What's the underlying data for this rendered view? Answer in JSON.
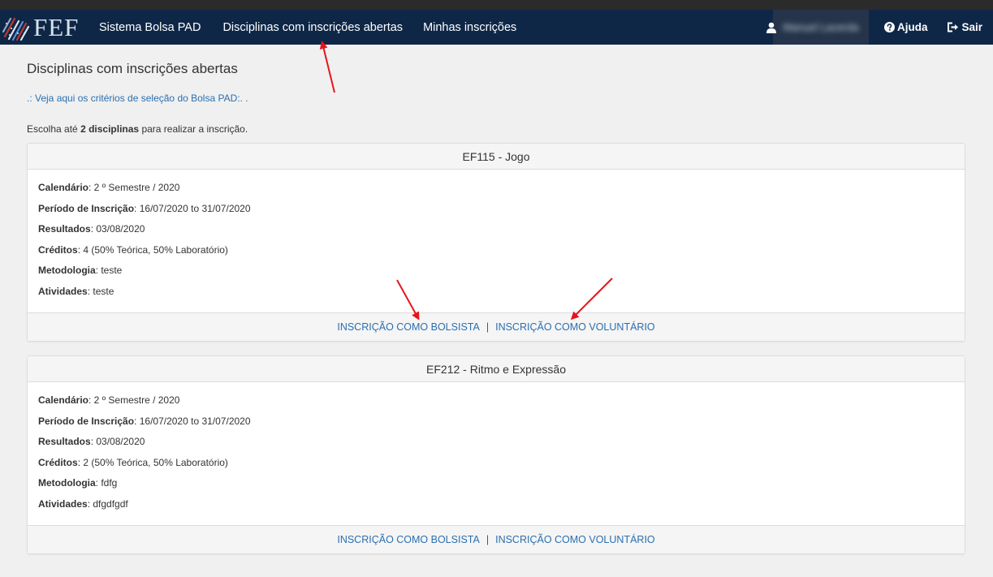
{
  "brand": {
    "name": "FEF"
  },
  "nav": {
    "system": "Sistema Bolsa PAD",
    "open": "Disciplinas com inscrições abertas",
    "mine": "Minhas inscrições",
    "user_name": "Manuel Lacerda",
    "help": "Ajuda",
    "exit": "Sair"
  },
  "page": {
    "title": "Disciplinas com inscrições abertas",
    "criteria_link": ".: Veja aqui os critérios de seleção do Bolsa PAD:. .",
    "instruction_prefix": "Escolha até",
    "instruction_bold": "2 disciplinas",
    "instruction_suffix": "para realizar a inscrição."
  },
  "labels": {
    "calendar": "Calendário",
    "period": "Período de Inscrição",
    "results": "Resultados",
    "credits": "Créditos",
    "methodology": "Metodologia",
    "activities": "Atividades"
  },
  "actions": {
    "scholar": "INSCRIÇÃO COMO BOLSISTA",
    "separator": "|",
    "volunteer": "INSCRIÇÃO COMO VOLUNTÁRIO"
  },
  "courses": [
    {
      "title": "EF115 - Jogo",
      "calendar": ": 2 º Semestre / 2020",
      "period": ": 16/07/2020 to 31/07/2020",
      "results": ": 03/08/2020",
      "credits": ": 4 (50% Teórica, 50% Laboratório)",
      "methodology": ": teste",
      "activities": ": teste"
    },
    {
      "title": "EF212 - Ritmo e Expressão",
      "calendar": ": 2 º Semestre / 2020",
      "period": ": 16/07/2020 to 31/07/2020",
      "results": ": 03/08/2020",
      "credits": ": 2 (50% Teórica, 50% Laboratório)",
      "methodology": ": fdfg",
      "activities": ": dfgdfgdf"
    }
  ],
  "colors": {
    "navbar": "#0f2747",
    "link": "#2a6fb0",
    "annotation_arrow": "#e8141b"
  },
  "icons": [
    "fef-logo-icon",
    "user-icon",
    "question-circle-icon",
    "sign-out-icon",
    "annotation-arrow"
  ]
}
